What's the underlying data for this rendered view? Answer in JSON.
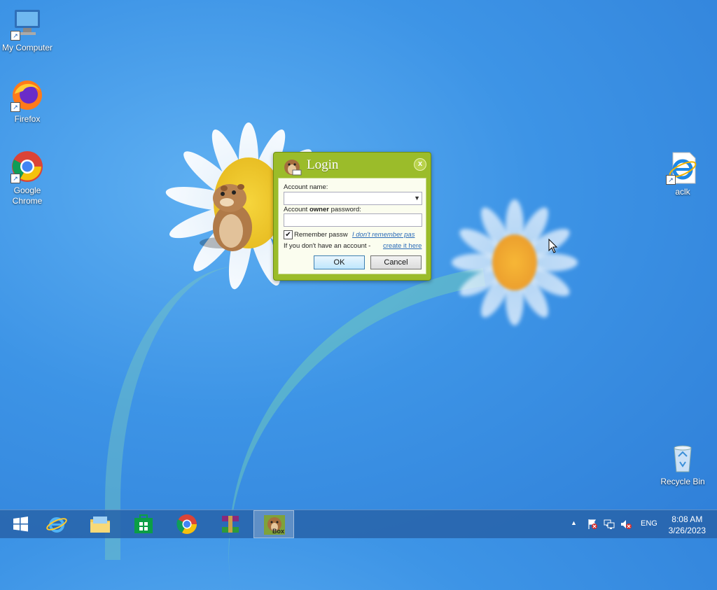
{
  "desktop_icons": {
    "my_computer": "My Computer",
    "firefox": "Firefox",
    "chrome": "Google Chrome",
    "aclk": "aclk",
    "recycle_bin": "Recycle Bin"
  },
  "login_dialog": {
    "title": "Login",
    "close_glyph": "x",
    "account_name_label": "Account name:",
    "account_name_value": "",
    "owner_password_prefix": "Account ",
    "owner_password_bold": "owner",
    "owner_password_suffix": " password:",
    "password_value": "",
    "remember_label": "Remember passw",
    "remember_checked": true,
    "forgot_link": "I don't remember pas",
    "no_account_text": "If you don't have an account -",
    "create_link": "create it here",
    "ok_label": "OK",
    "cancel_label": "Cancel"
  },
  "taskbar": {
    "language": "ENG",
    "time": "8:08 AM",
    "date": "3/26/2023",
    "box_label": "Box"
  },
  "colors": {
    "dialog_frame": "#9bbc2a",
    "taskbar": "#2864aa",
    "desktop": "#3d94e6"
  }
}
